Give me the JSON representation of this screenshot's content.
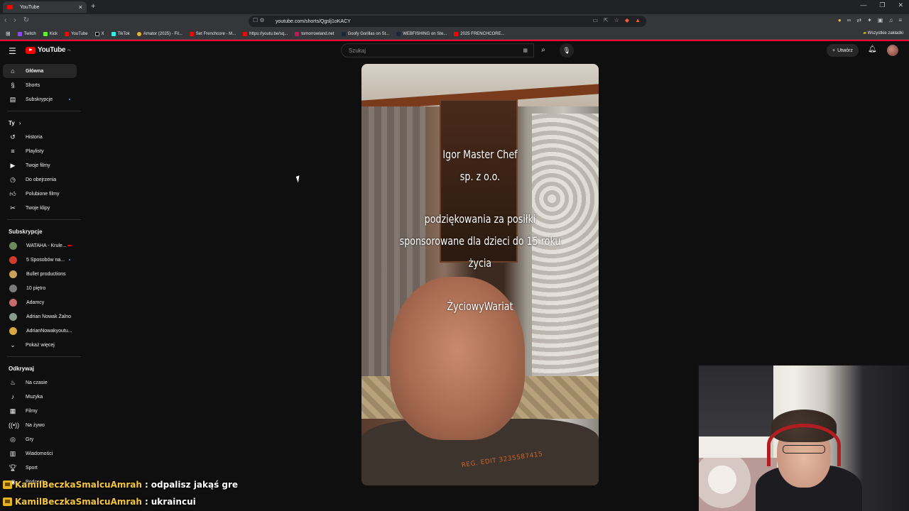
{
  "browser": {
    "tab_title": "YouTube",
    "url": "youtube.com/shorts/Qgslj1oKACY",
    "bookmarks": [
      "Twitch",
      "Kick",
      "YouTube",
      "X",
      "TikTok",
      "Amator (2025) - Fil...",
      "Set Frenchcore - M...",
      "https://youtu.be/sq...",
      "tomorrowland.net",
      "Goofy Gorillas on St...",
      "WEBFISHING on Ste...",
      "2025 FRENCHCORE..."
    ],
    "bookmarks_right": "Wszystkie zakładki"
  },
  "header": {
    "logo_text": "YouTube",
    "logo_country": "PL",
    "search_placeholder": "Szukaj",
    "create_label": "Utwórz"
  },
  "sidebar": {
    "main": [
      {
        "label": "Główna",
        "icon": "home-icon"
      },
      {
        "label": "Shorts",
        "icon": "shorts-icon"
      },
      {
        "label": "Subskrypcje",
        "icon": "subscriptions-icon"
      }
    ],
    "you_heading": "Ty",
    "you": [
      {
        "label": "Historia",
        "icon": "history-icon"
      },
      {
        "label": "Playlisty",
        "icon": "playlists-icon"
      },
      {
        "label": "Twoje filmy",
        "icon": "your-videos-icon"
      },
      {
        "label": "Do obejrzenia",
        "icon": "watch-later-icon"
      },
      {
        "label": "Polubione filmy",
        "icon": "liked-icon"
      },
      {
        "label": "Twoje klipy",
        "icon": "clips-icon"
      }
    ],
    "subs_heading": "Subskrypcje",
    "subs": [
      {
        "label": "WATAHA - Krule...",
        "color": "#6a8a5a"
      },
      {
        "label": "5 Sposobów na...",
        "color": "#d23a2a"
      },
      {
        "label": "Bullet productions",
        "color": "#c9a25a"
      },
      {
        "label": "10 piętro",
        "color": "#7a7a7a"
      },
      {
        "label": "Adamcy",
        "color": "#c96a6a"
      },
      {
        "label": "Adrian Nowak Żalno",
        "color": "#8a9a8a"
      },
      {
        "label": "AdrianNowakyoutu...",
        "color": "#d8a840"
      }
    ],
    "show_more": "Pokaż więcej",
    "explore_heading": "Odkrywaj",
    "explore": [
      {
        "label": "Na czasie",
        "icon": "trending-icon"
      },
      {
        "label": "Muzyka",
        "icon": "music-icon"
      },
      {
        "label": "Filmy",
        "icon": "movies-icon"
      },
      {
        "label": "Na żywo",
        "icon": "live-icon"
      },
      {
        "label": "Gry",
        "icon": "gaming-icon"
      },
      {
        "label": "Wiadomości",
        "icon": "news-icon"
      },
      {
        "label": "Sport",
        "icon": "sport-icon"
      },
      {
        "label": "Podcasty",
        "icon": "podcasts-icon"
      }
    ]
  },
  "short": {
    "caption_1": "Igor Master Chef\nsp. z o.o.",
    "caption_2": "podziękowania za posiłki\nsponsorowane dla dzieci do 15 roku\nżycia",
    "caption_3": "ŻyciowyWariat",
    "shirt_text": "REG. EDIT 3235587415"
  },
  "chat": [
    {
      "user": "KamilBeczkaSmalcuAmrah",
      "message": "odpalisz jakąś gre"
    },
    {
      "user": "KamilBeczkaSmalcuAmrah",
      "message": "ukraincui"
    }
  ]
}
